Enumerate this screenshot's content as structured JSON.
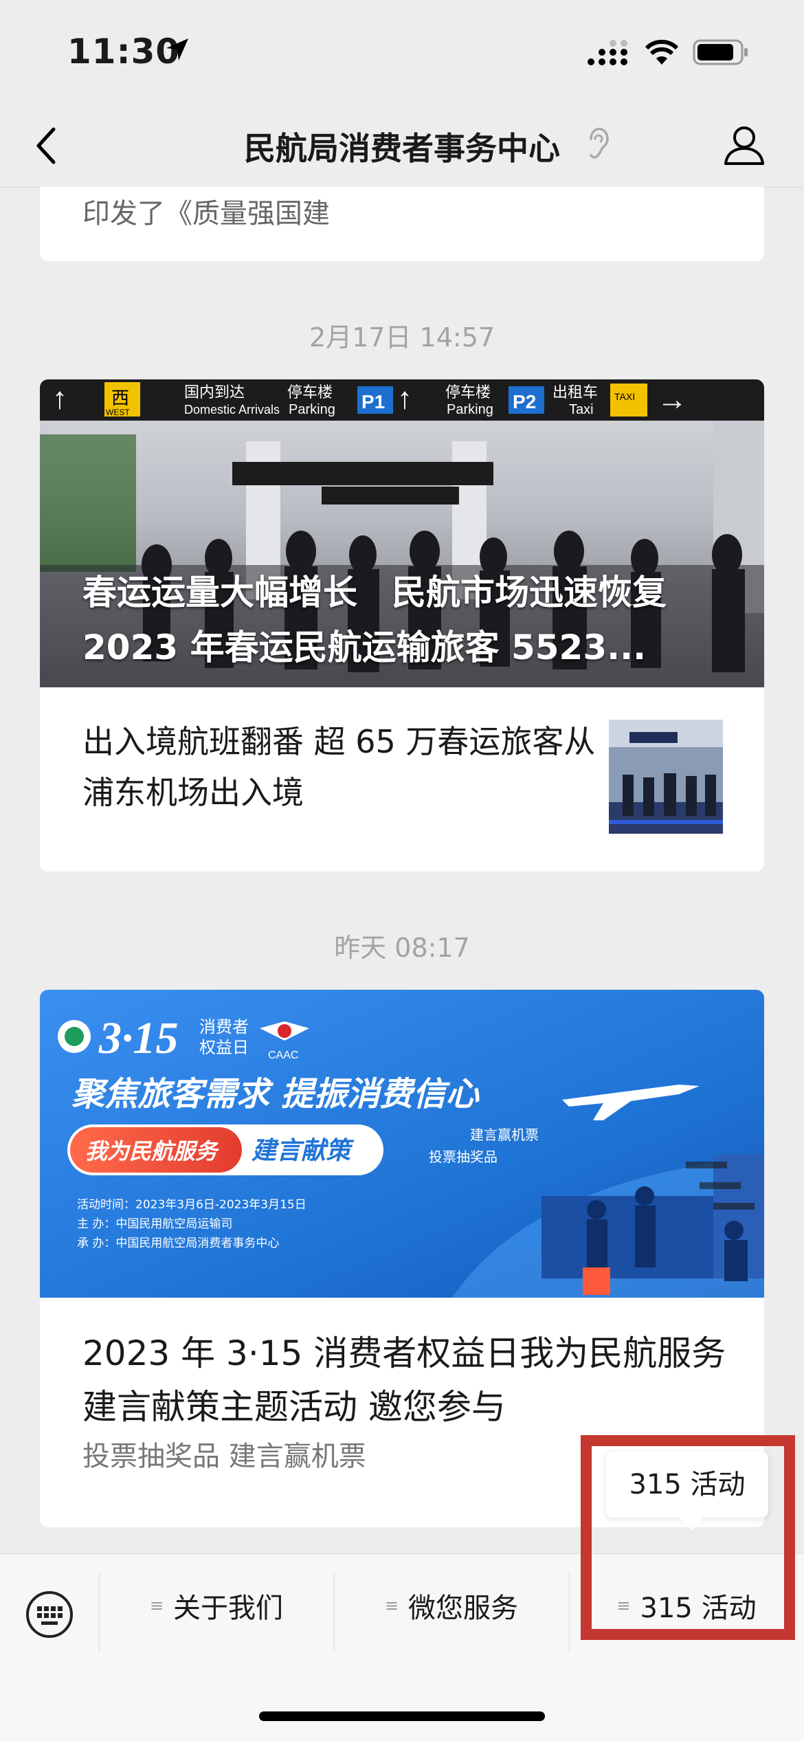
{
  "status_bar": {
    "time": "11:30"
  },
  "nav": {
    "title": "民航局消费者事务中心"
  },
  "card1": {
    "snippet": "印发了《质量强国建"
  },
  "group2": {
    "timestamp": "2月17日 14:57",
    "hero_title": "春运运量大幅增长　民航市场迅速恢复 2023 年春运民航运输旅客 5523...",
    "signs": [
      "西",
      "WEST",
      "国内到达",
      "Domestic Arrivals",
      "停车楼",
      "Parking",
      "P1",
      "停车楼",
      "Parking",
      "P2",
      "出租车",
      "Taxi",
      "TAXI"
    ],
    "sub_item": "出入境航班翻番 超 65 万春运旅客从浦东机场出入境"
  },
  "group3": {
    "timestamp": "昨天 08:17",
    "banner": {
      "logo": "3·15",
      "logo_caption_1": "消费者",
      "logo_caption_2": "权益日",
      "caac": "CAAC",
      "headline": "聚焦旅客需求 提振消费信心",
      "pill_left": "我为民航服务",
      "pill_right": "建言献策",
      "tag1": "建言赢机票",
      "tag2": "投票抽奖品",
      "info1": "活动时间：2023年3月6日-2023年3月15日",
      "info2": "主  办：中国民用航空局运输司",
      "info3": "承  办：中国民用航空局消费者事务中心"
    },
    "title": "2023 年 3·15 消费者权益日我为民航服务建言献策主题活动 邀您参与",
    "subtitle": "投票抽奖品 建言赢机票"
  },
  "popup": {
    "label": "315 活动"
  },
  "menu": {
    "items": [
      {
        "label": "关于我们"
      },
      {
        "label": "微您服务"
      },
      {
        "label": "315 活动"
      }
    ]
  },
  "colors": {
    "highlight": "#c4382f",
    "banner_blue": "#1f74d6"
  }
}
